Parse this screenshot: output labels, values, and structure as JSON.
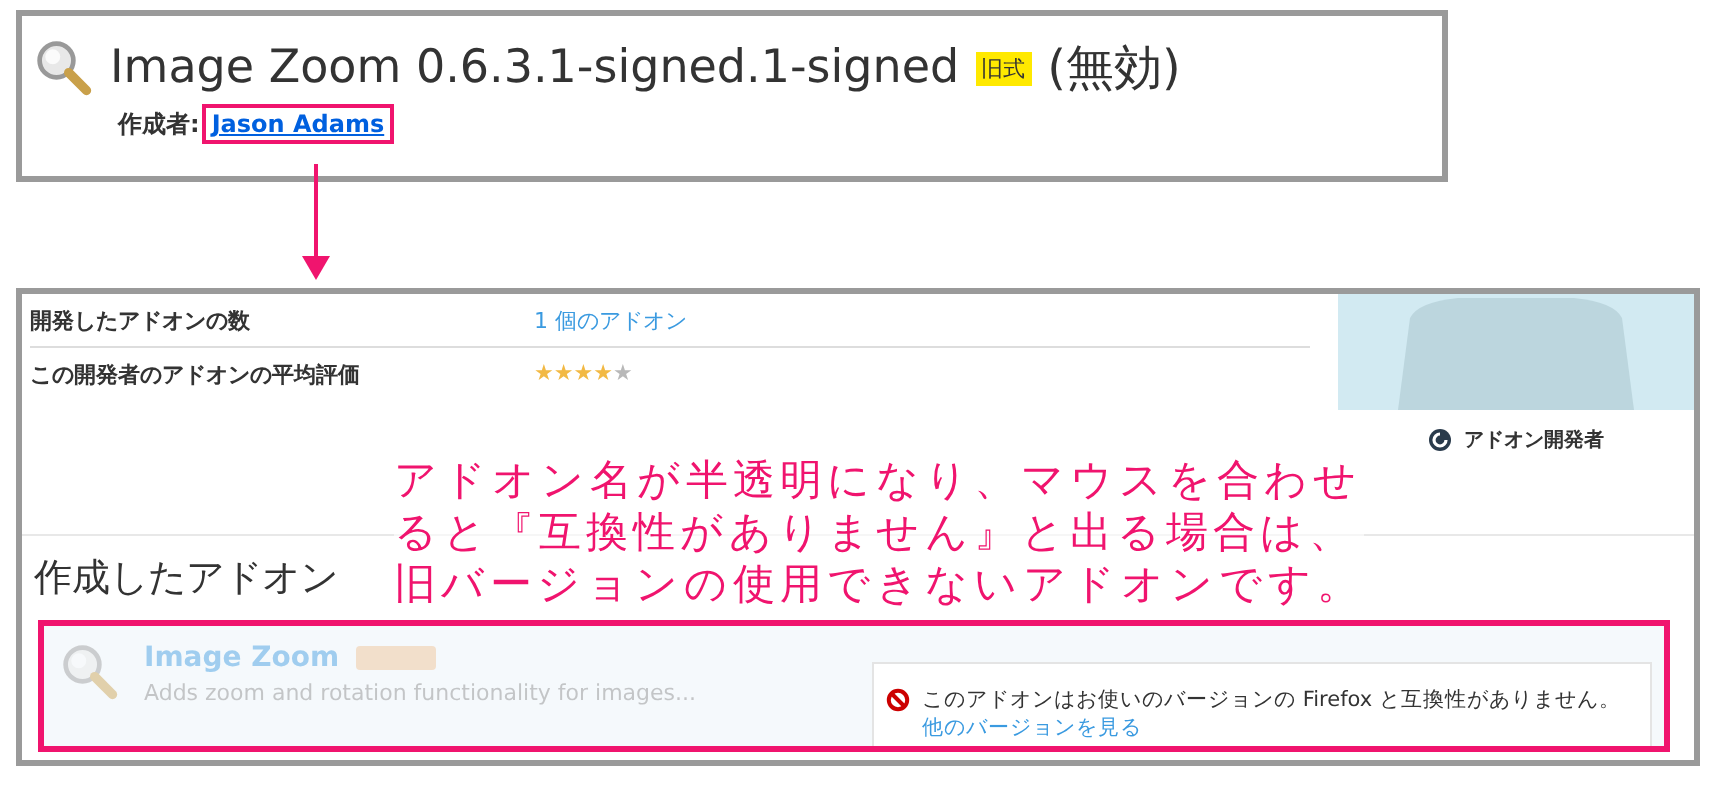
{
  "header": {
    "title": "Image Zoom 0.6.3.1-signed.1-signed",
    "badge": "旧式",
    "status": "(無効)",
    "author_label": "作成者:",
    "author": "Jason Adams"
  },
  "developer": {
    "rows": [
      {
        "kind": "link",
        "label": "開発したアドオンの数",
        "value": "1 個のアドオン"
      },
      {
        "kind": "stars",
        "label": "この開発者のアドオンの平均評価",
        "stars": 4
      }
    ],
    "role": "アドオン開発者"
  },
  "annotation": {
    "lines": [
      "アドオン名が半透明になり、マウスを合わせ",
      "ると『互換性がありません』と出る場合は、",
      "旧バージョンの使用できないアドオンです。"
    ]
  },
  "section_title": "作成したアドオン",
  "addons": [
    {
      "name": "Image Zoom",
      "description": "Adds zoom and rotation functionality for images...",
      "compatible": false,
      "warning": "このアドオンはお使いのバージョンの Firefox と互換性がありません。",
      "warning_link": "他のバージョンを見る"
    }
  ]
}
